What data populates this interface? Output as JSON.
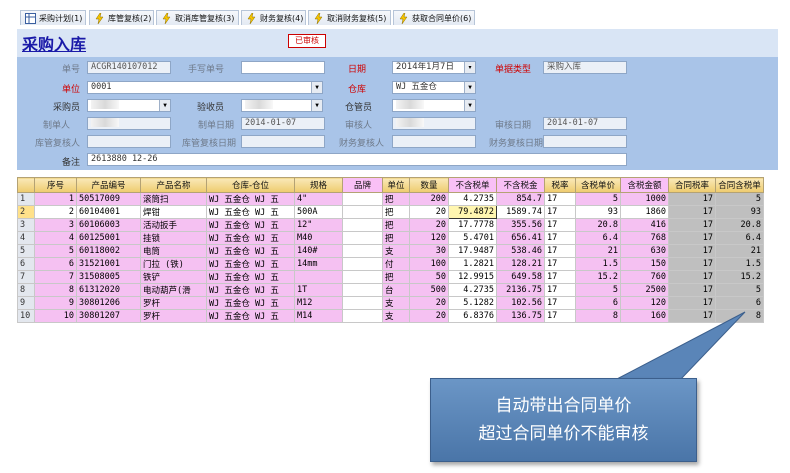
{
  "toolbar": {
    "tabs": [
      {
        "label": "采购计划(1)",
        "icon": "table-icon"
      },
      {
        "label": "库管复核(2)",
        "icon": "lightning-icon"
      },
      {
        "label": "取消库管复核(3)",
        "icon": "lightning-icon"
      },
      {
        "label": "财务复核(4)",
        "icon": "lightning-icon"
      },
      {
        "label": "取消财务复核(5)",
        "icon": "lightning-icon"
      },
      {
        "label": "获取合同单价(6)",
        "icon": "lightning-icon"
      }
    ]
  },
  "header": {
    "title": "采购入库",
    "status_badge": "已审核"
  },
  "form": {
    "doc_no_label": "单号",
    "doc_no": "ACGR140107012",
    "manual_no_label": "手写单号",
    "manual_no": "",
    "date_label": "日期",
    "date": "2014年1月7日",
    "doc_type_label": "单据类型",
    "doc_type": "采购入库",
    "unit_label": "单位",
    "unit": "0001",
    "warehouse_label": "仓库",
    "warehouse": "WJ 五金仓",
    "buyer_label": "采购员",
    "receiver_label": "验收员",
    "keeper_label": "仓管员",
    "maker_label": "制单人",
    "make_date_label": "制单日期",
    "make_date": "2014-01-07",
    "auditor_label": "审核人",
    "audit_date_label": "审核日期",
    "audit_date": "2014-01-07",
    "stock_reviewer_label": "库管复核人",
    "stock_review_date_label": "库管复核日期",
    "finance_reviewer_label": "财务复核人",
    "finance_review_date_label": "财务复核日期",
    "remark_label": "备注",
    "remark": "2613880  12-26"
  },
  "grid": {
    "columns": [
      "序号",
      "产品编号",
      "产品名称",
      "仓库-仓位",
      "规格",
      "品牌",
      "单位",
      "数量",
      "不含税单",
      "不含税金",
      "税率",
      "含税单价",
      "含税金额",
      "合同税率",
      "合同含税单"
    ],
    "rows": [
      {
        "row": "1",
        "seq": "1",
        "code": "50517009",
        "name": "滚筒扫",
        "wh": "WJ 五金仓 WJ 五",
        "spec": "4\"",
        "brand": "",
        "unit": "把",
        "qty": "200",
        "price": "4.2735",
        "amount": "854.7",
        "rate": "17",
        "tax_price": "5",
        "tax_amount": "1000",
        "c_rate": "17",
        "c_price": "5"
      },
      {
        "row": "2",
        "seq": "2",
        "code": "60104001",
        "name": "焊钳",
        "wh": "WJ 五金仓 WJ 五",
        "spec": "500A",
        "brand": "",
        "unit": "把",
        "qty": "20",
        "price": "79.4872",
        "amount": "1589.74",
        "rate": "17",
        "tax_price": "93",
        "tax_amount": "1860",
        "c_rate": "17",
        "c_price": "93"
      },
      {
        "row": "3",
        "seq": "3",
        "code": "60106003",
        "name": "活动扳手",
        "wh": "WJ 五金仓 WJ 五",
        "spec": "12\"",
        "brand": "",
        "unit": "把",
        "qty": "20",
        "price": "17.7778",
        "amount": "355.56",
        "rate": "17",
        "tax_price": "20.8",
        "tax_amount": "416",
        "c_rate": "17",
        "c_price": "20.8"
      },
      {
        "row": "4",
        "seq": "4",
        "code": "60125001",
        "name": "挂锁",
        "wh": "WJ 五金仓 WJ 五",
        "spec": "M40",
        "brand": "",
        "unit": "把",
        "qty": "120",
        "price": "5.4701",
        "amount": "656.41",
        "rate": "17",
        "tax_price": "6.4",
        "tax_amount": "768",
        "c_rate": "17",
        "c_price": "6.4"
      },
      {
        "row": "5",
        "seq": "5",
        "code": "60118002",
        "name": "电筒",
        "wh": "WJ 五金仓 WJ 五",
        "spec": "140#",
        "brand": "",
        "unit": "支",
        "qty": "30",
        "price": "17.9487",
        "amount": "538.46",
        "rate": "17",
        "tax_price": "21",
        "tax_amount": "630",
        "c_rate": "17",
        "c_price": "21"
      },
      {
        "row": "6",
        "seq": "6",
        "code": "31521001",
        "name": "门拉 (铁)",
        "wh": "WJ 五金仓 WJ 五",
        "spec": "14mm",
        "brand": "",
        "unit": "付",
        "qty": "100",
        "price": "1.2821",
        "amount": "128.21",
        "rate": "17",
        "tax_price": "1.5",
        "tax_amount": "150",
        "c_rate": "17",
        "c_price": "1.5"
      },
      {
        "row": "7",
        "seq": "7",
        "code": "31508005",
        "name": "铁铲",
        "wh": "WJ 五金仓 WJ 五",
        "spec": "",
        "brand": "",
        "unit": "把",
        "qty": "50",
        "price": "12.9915",
        "amount": "649.58",
        "rate": "17",
        "tax_price": "15.2",
        "tax_amount": "760",
        "c_rate": "17",
        "c_price": "15.2"
      },
      {
        "row": "8",
        "seq": "8",
        "code": "61312020",
        "name": "电动葫芦(滑",
        "wh": "WJ 五金仓 WJ 五",
        "spec": "1T",
        "brand": "",
        "unit": "台",
        "qty": "500",
        "price": "4.2735",
        "amount": "2136.75",
        "rate": "17",
        "tax_price": "5",
        "tax_amount": "2500",
        "c_rate": "17",
        "c_price": "5"
      },
      {
        "row": "9",
        "seq": "9",
        "code": "30801206",
        "name": "罗杆",
        "wh": "WJ 五金仓 WJ 五",
        "spec": "M12",
        "brand": "",
        "unit": "支",
        "qty": "20",
        "price": "5.1282",
        "amount": "102.56",
        "rate": "17",
        "tax_price": "6",
        "tax_amount": "120",
        "c_rate": "17",
        "c_price": "6"
      },
      {
        "row": "10",
        "seq": "10",
        "code": "30801207",
        "name": "罗杆",
        "wh": "WJ 五金仓 WJ 五",
        "spec": "M14",
        "brand": "",
        "unit": "支",
        "qty": "20",
        "price": "6.8376",
        "amount": "136.75",
        "rate": "17",
        "tax_price": "8",
        "tax_amount": "160",
        "c_rate": "17",
        "c_price": "8"
      }
    ]
  },
  "callout": {
    "line1": "自动带出合同单价",
    "line2": "超过合同单价不能审核"
  },
  "colors": {
    "panel": "#a9c4e8",
    "pink": "#f5c1f2",
    "header_gold": "#eecb6d",
    "callout": "#5a85b8"
  }
}
